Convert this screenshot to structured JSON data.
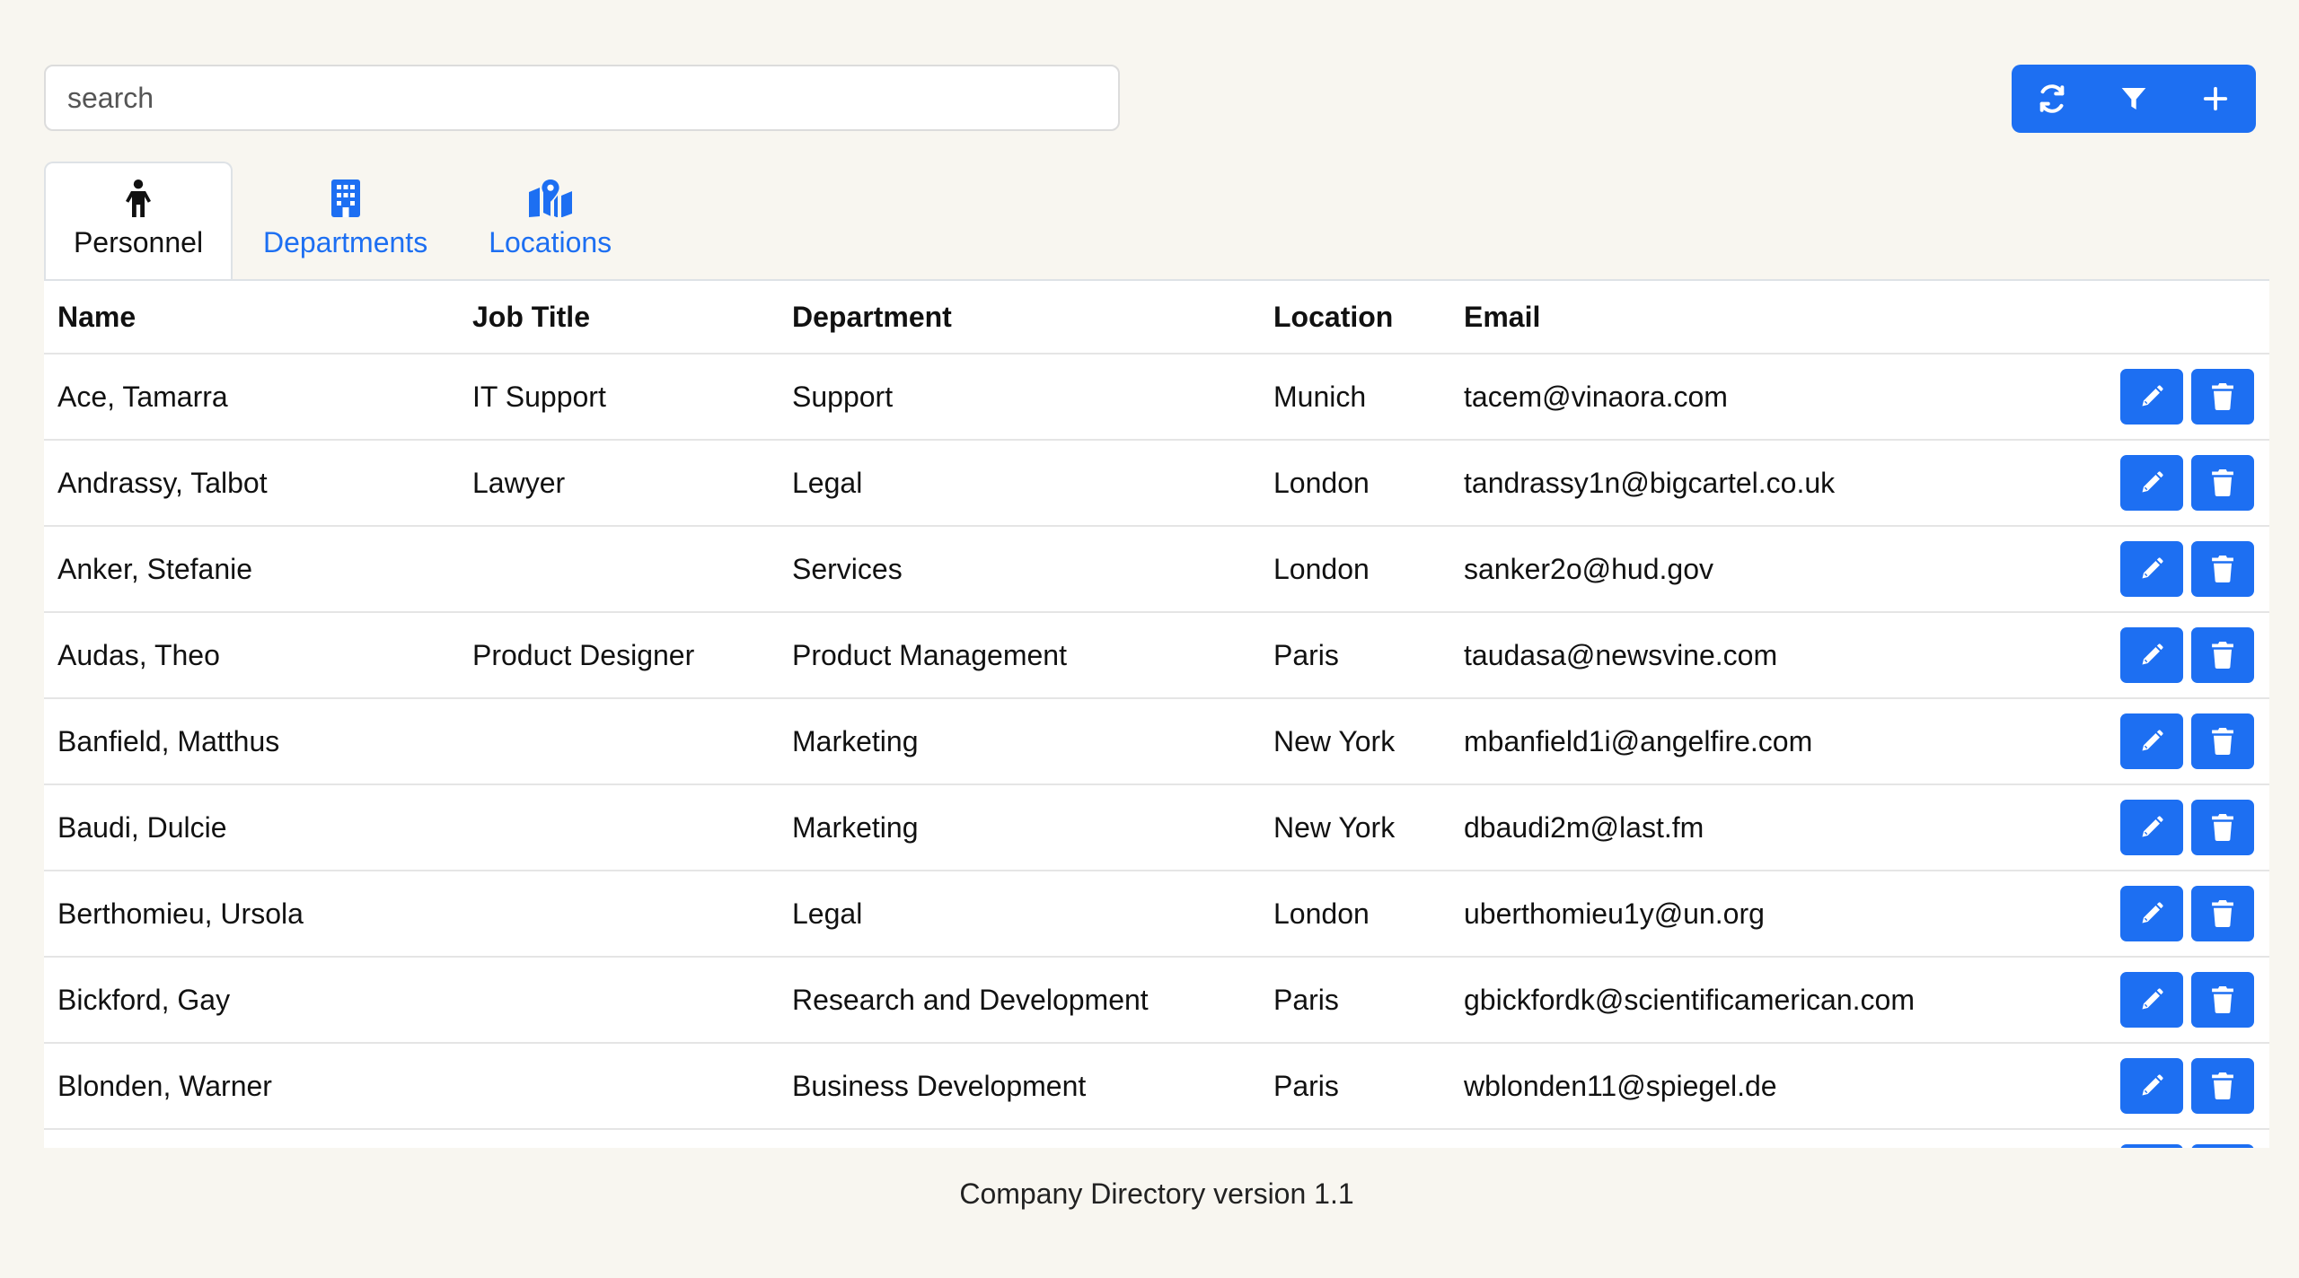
{
  "search": {
    "placeholder": "search"
  },
  "toolbar": {
    "refresh_icon": "refresh-icon",
    "filter_icon": "filter-icon",
    "add_icon": "plus-icon"
  },
  "tabs": [
    {
      "label": "Personnel",
      "icon": "person-icon",
      "active": true
    },
    {
      "label": "Departments",
      "icon": "building-icon",
      "active": false
    },
    {
      "label": "Locations",
      "icon": "map-pin-icon",
      "active": false
    }
  ],
  "table": {
    "headers": {
      "name": "Name",
      "job": "Job Title",
      "department": "Department",
      "location": "Location",
      "email": "Email"
    },
    "rows": [
      {
        "name": "Ace, Tamarra",
        "job": "IT Support",
        "department": "Support",
        "location": "Munich",
        "email": "tacem@vinaora.com"
      },
      {
        "name": "Andrassy, Talbot",
        "job": "Lawyer",
        "department": "Legal",
        "location": "London",
        "email": "tandrassy1n@bigcartel.co.uk"
      },
      {
        "name": "Anker, Stefanie",
        "job": "",
        "department": "Services",
        "location": "London",
        "email": "sanker2o@hud.gov"
      },
      {
        "name": "Audas, Theo",
        "job": "Product Designer",
        "department": "Product Management",
        "location": "Paris",
        "email": "taudasa@newsvine.com"
      },
      {
        "name": "Banfield, Matthus",
        "job": "",
        "department": "Marketing",
        "location": "New York",
        "email": "mbanfield1i@angelfire.com"
      },
      {
        "name": "Baudi, Dulcie",
        "job": "",
        "department": "Marketing",
        "location": "New York",
        "email": "dbaudi2m@last.fm"
      },
      {
        "name": "Berthomieu, Ursola",
        "job": "",
        "department": "Legal",
        "location": "London",
        "email": "uberthomieu1y@un.org"
      },
      {
        "name": "Bickford, Gay",
        "job": "",
        "department": "Research and Development",
        "location": "Paris",
        "email": "gbickfordk@scientificamerican.com"
      },
      {
        "name": "Blonden, Warner",
        "job": "",
        "department": "Business Development",
        "location": "Paris",
        "email": "wblonden11@spiegel.de"
      },
      {
        "name": "",
        "job": "",
        "department": "",
        "location": "",
        "email": ""
      }
    ]
  },
  "footer": {
    "text": "Company Directory version 1.1"
  },
  "colors": {
    "accent": "#1d6ff2",
    "background": "#f8f6f0"
  }
}
